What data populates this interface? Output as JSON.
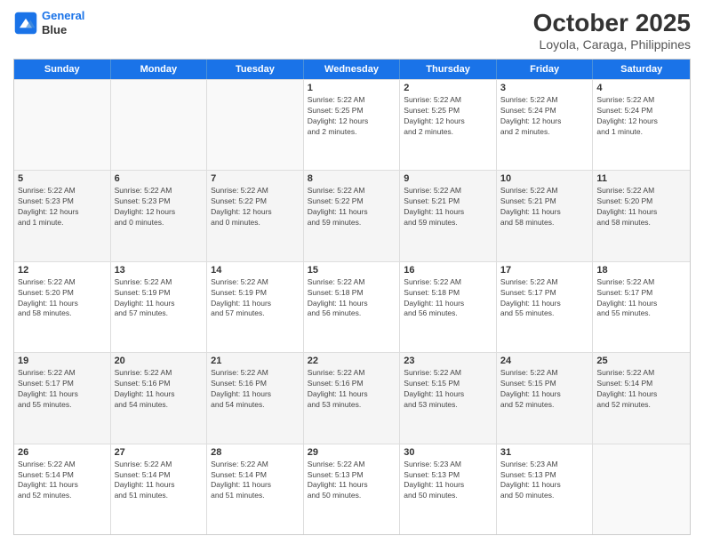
{
  "header": {
    "logo_line1": "General",
    "logo_line2": "Blue",
    "month_year": "October 2025",
    "location": "Loyola, Caraga, Philippines"
  },
  "weekdays": [
    "Sunday",
    "Monday",
    "Tuesday",
    "Wednesday",
    "Thursday",
    "Friday",
    "Saturday"
  ],
  "rows": [
    [
      {
        "day": "",
        "info": ""
      },
      {
        "day": "",
        "info": ""
      },
      {
        "day": "",
        "info": ""
      },
      {
        "day": "1",
        "info": "Sunrise: 5:22 AM\nSunset: 5:25 PM\nDaylight: 12 hours\nand 2 minutes."
      },
      {
        "day": "2",
        "info": "Sunrise: 5:22 AM\nSunset: 5:25 PM\nDaylight: 12 hours\nand 2 minutes."
      },
      {
        "day": "3",
        "info": "Sunrise: 5:22 AM\nSunset: 5:24 PM\nDaylight: 12 hours\nand 2 minutes."
      },
      {
        "day": "4",
        "info": "Sunrise: 5:22 AM\nSunset: 5:24 PM\nDaylight: 12 hours\nand 1 minute."
      }
    ],
    [
      {
        "day": "5",
        "info": "Sunrise: 5:22 AM\nSunset: 5:23 PM\nDaylight: 12 hours\nand 1 minute."
      },
      {
        "day": "6",
        "info": "Sunrise: 5:22 AM\nSunset: 5:23 PM\nDaylight: 12 hours\nand 0 minutes."
      },
      {
        "day": "7",
        "info": "Sunrise: 5:22 AM\nSunset: 5:22 PM\nDaylight: 12 hours\nand 0 minutes."
      },
      {
        "day": "8",
        "info": "Sunrise: 5:22 AM\nSunset: 5:22 PM\nDaylight: 11 hours\nand 59 minutes."
      },
      {
        "day": "9",
        "info": "Sunrise: 5:22 AM\nSunset: 5:21 PM\nDaylight: 11 hours\nand 59 minutes."
      },
      {
        "day": "10",
        "info": "Sunrise: 5:22 AM\nSunset: 5:21 PM\nDaylight: 11 hours\nand 58 minutes."
      },
      {
        "day": "11",
        "info": "Sunrise: 5:22 AM\nSunset: 5:20 PM\nDaylight: 11 hours\nand 58 minutes."
      }
    ],
    [
      {
        "day": "12",
        "info": "Sunrise: 5:22 AM\nSunset: 5:20 PM\nDaylight: 11 hours\nand 58 minutes."
      },
      {
        "day": "13",
        "info": "Sunrise: 5:22 AM\nSunset: 5:19 PM\nDaylight: 11 hours\nand 57 minutes."
      },
      {
        "day": "14",
        "info": "Sunrise: 5:22 AM\nSunset: 5:19 PM\nDaylight: 11 hours\nand 57 minutes."
      },
      {
        "day": "15",
        "info": "Sunrise: 5:22 AM\nSunset: 5:18 PM\nDaylight: 11 hours\nand 56 minutes."
      },
      {
        "day": "16",
        "info": "Sunrise: 5:22 AM\nSunset: 5:18 PM\nDaylight: 11 hours\nand 56 minutes."
      },
      {
        "day": "17",
        "info": "Sunrise: 5:22 AM\nSunset: 5:17 PM\nDaylight: 11 hours\nand 55 minutes."
      },
      {
        "day": "18",
        "info": "Sunrise: 5:22 AM\nSunset: 5:17 PM\nDaylight: 11 hours\nand 55 minutes."
      }
    ],
    [
      {
        "day": "19",
        "info": "Sunrise: 5:22 AM\nSunset: 5:17 PM\nDaylight: 11 hours\nand 55 minutes."
      },
      {
        "day": "20",
        "info": "Sunrise: 5:22 AM\nSunset: 5:16 PM\nDaylight: 11 hours\nand 54 minutes."
      },
      {
        "day": "21",
        "info": "Sunrise: 5:22 AM\nSunset: 5:16 PM\nDaylight: 11 hours\nand 54 minutes."
      },
      {
        "day": "22",
        "info": "Sunrise: 5:22 AM\nSunset: 5:16 PM\nDaylight: 11 hours\nand 53 minutes."
      },
      {
        "day": "23",
        "info": "Sunrise: 5:22 AM\nSunset: 5:15 PM\nDaylight: 11 hours\nand 53 minutes."
      },
      {
        "day": "24",
        "info": "Sunrise: 5:22 AM\nSunset: 5:15 PM\nDaylight: 11 hours\nand 52 minutes."
      },
      {
        "day": "25",
        "info": "Sunrise: 5:22 AM\nSunset: 5:14 PM\nDaylight: 11 hours\nand 52 minutes."
      }
    ],
    [
      {
        "day": "26",
        "info": "Sunrise: 5:22 AM\nSunset: 5:14 PM\nDaylight: 11 hours\nand 52 minutes."
      },
      {
        "day": "27",
        "info": "Sunrise: 5:22 AM\nSunset: 5:14 PM\nDaylight: 11 hours\nand 51 minutes."
      },
      {
        "day": "28",
        "info": "Sunrise: 5:22 AM\nSunset: 5:14 PM\nDaylight: 11 hours\nand 51 minutes."
      },
      {
        "day": "29",
        "info": "Sunrise: 5:22 AM\nSunset: 5:13 PM\nDaylight: 11 hours\nand 50 minutes."
      },
      {
        "day": "30",
        "info": "Sunrise: 5:23 AM\nSunset: 5:13 PM\nDaylight: 11 hours\nand 50 minutes."
      },
      {
        "day": "31",
        "info": "Sunrise: 5:23 AM\nSunset: 5:13 PM\nDaylight: 11 hours\nand 50 minutes."
      },
      {
        "day": "",
        "info": ""
      }
    ]
  ]
}
